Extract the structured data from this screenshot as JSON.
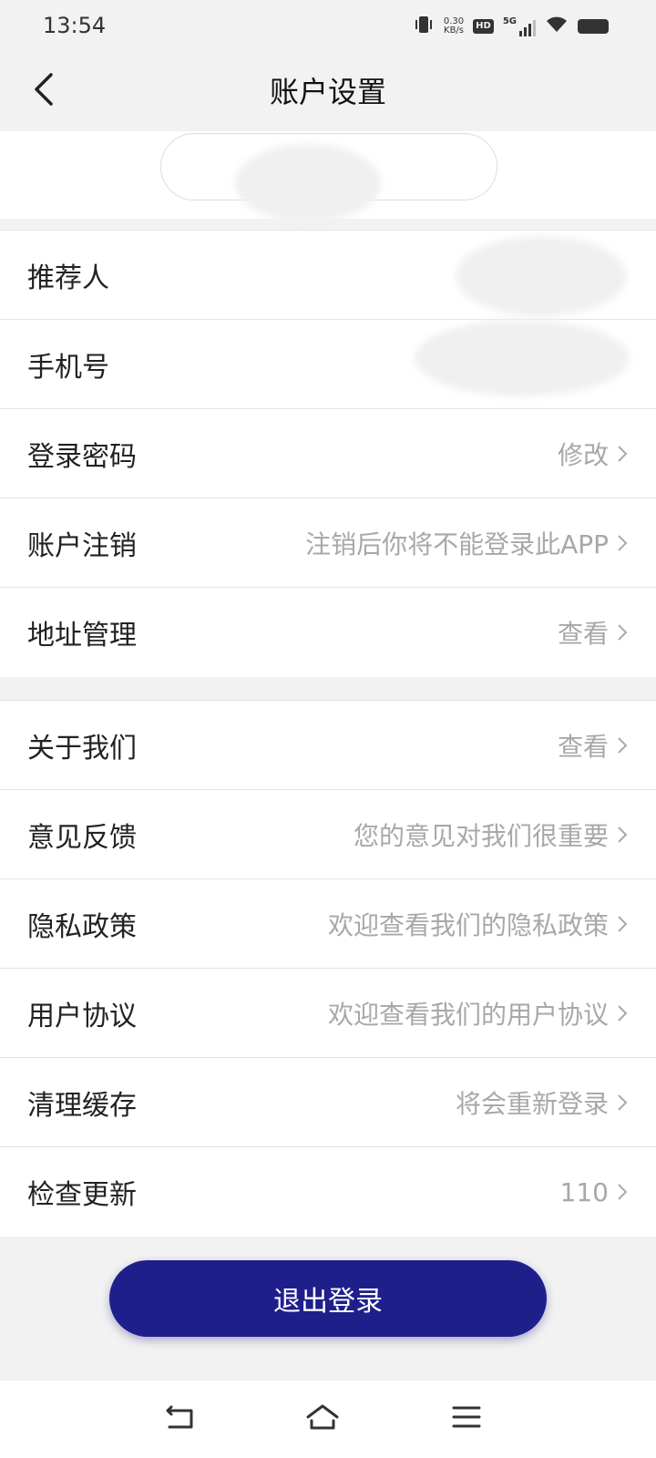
{
  "status_bar": {
    "time": "13:54",
    "net_speed_value": "0.30",
    "net_speed_unit": "KB/s",
    "hd_label": "HD",
    "network_label": "5G",
    "icons": [
      "vibrate-icon",
      "hd-icon",
      "signal-icon",
      "wifi-icon",
      "battery-icon"
    ]
  },
  "nav": {
    "title": "账户设置",
    "back_icon": "chevron-left-icon"
  },
  "groups": [
    {
      "rows": [
        {
          "label": "推荐人",
          "value": ""
        },
        {
          "label": "手机号",
          "value": ""
        },
        {
          "label": "登录密码",
          "value": "修改"
        },
        {
          "label": "账户注销",
          "value": "注销后你将不能登录此APP"
        },
        {
          "label": "地址管理",
          "value": "查看"
        }
      ]
    },
    {
      "rows": [
        {
          "label": "关于我们",
          "value": "查看"
        },
        {
          "label": "意见反馈",
          "value": "您的意见对我们很重要"
        },
        {
          "label": "隐私政策",
          "value": "欢迎查看我们的隐私政策"
        },
        {
          "label": "用户协议",
          "value": "欢迎查看我们的用户协议"
        },
        {
          "label": "清理缓存",
          "value": "将会重新登录"
        },
        {
          "label": "检查更新",
          "value": "110"
        }
      ]
    }
  ],
  "logout": {
    "label": "退出登录"
  },
  "colors": {
    "accent": "#1f1f8c",
    "background": "#f2f2f2",
    "secondary_text": "#a8a8a8"
  },
  "system_nav": {
    "icons": [
      "back-nav-icon",
      "home-icon",
      "menu-icon"
    ]
  }
}
